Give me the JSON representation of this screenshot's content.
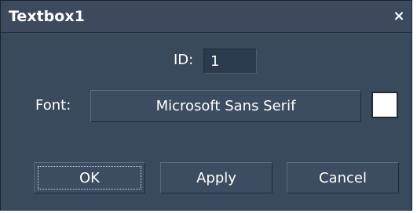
{
  "window": {
    "title": "Textbox1",
    "close_glyph": "×"
  },
  "form": {
    "id_label": "ID:",
    "id_value": "1",
    "font_label": "Font:",
    "font_value": "Microsoft Sans Serif",
    "font_color": "#ffffff"
  },
  "buttons": {
    "ok": "OK",
    "apply": "Apply",
    "cancel": "Cancel"
  },
  "colors": {
    "window_bg": "#3a4a5d",
    "titlebar_bg": "#3d4a5e",
    "text": "#ffffff"
  }
}
